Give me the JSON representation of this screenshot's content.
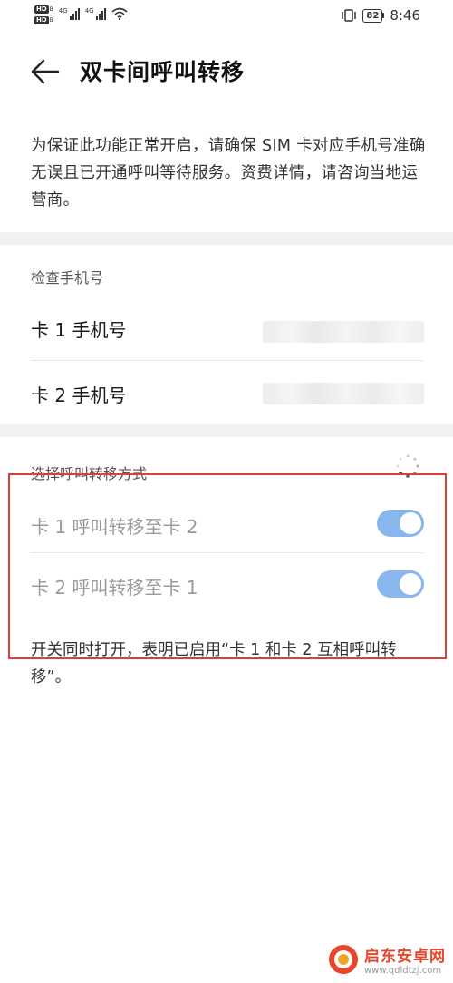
{
  "status_bar": {
    "hd1": "HD",
    "hd1_sub": "B",
    "hd2": "HD",
    "hd2_sub": "B",
    "net1": "4G",
    "net2": "4G",
    "battery": "82",
    "time": "8:46",
    "icons": [
      "vibrate-icon",
      "battery-icon",
      "wifi-icon",
      "signal-icon"
    ]
  },
  "header": {
    "title": "双卡间呼叫转移",
    "back_icon": "back-arrow-icon"
  },
  "info_text": "为保证此功能正常开启，请确保 SIM 卡对应手机号准确无误且已开通呼叫等待服务。资费详情，请咨询当地运营商。",
  "check_section": {
    "label": "检查手机号",
    "rows": [
      {
        "label": "卡 1 手机号"
      },
      {
        "label": "卡 2 手机号"
      }
    ]
  },
  "forward_section": {
    "label": "选择呼叫转移方式",
    "toggles": [
      {
        "label": "卡 1 呼叫转移至卡 2",
        "on": true
      },
      {
        "label": "卡 2 呼叫转移至卡 1",
        "on": true
      }
    ],
    "note": "开关同时打开，表明已启用“卡 1 和卡 2 互相呼叫转移”。"
  },
  "colors": {
    "toggle_on": "#8ab6ee",
    "highlight_frame": "#d9403a",
    "watermark": "#e8452b"
  },
  "watermark": {
    "name": "启东安卓网",
    "url": "www.qdldtzj.com"
  }
}
